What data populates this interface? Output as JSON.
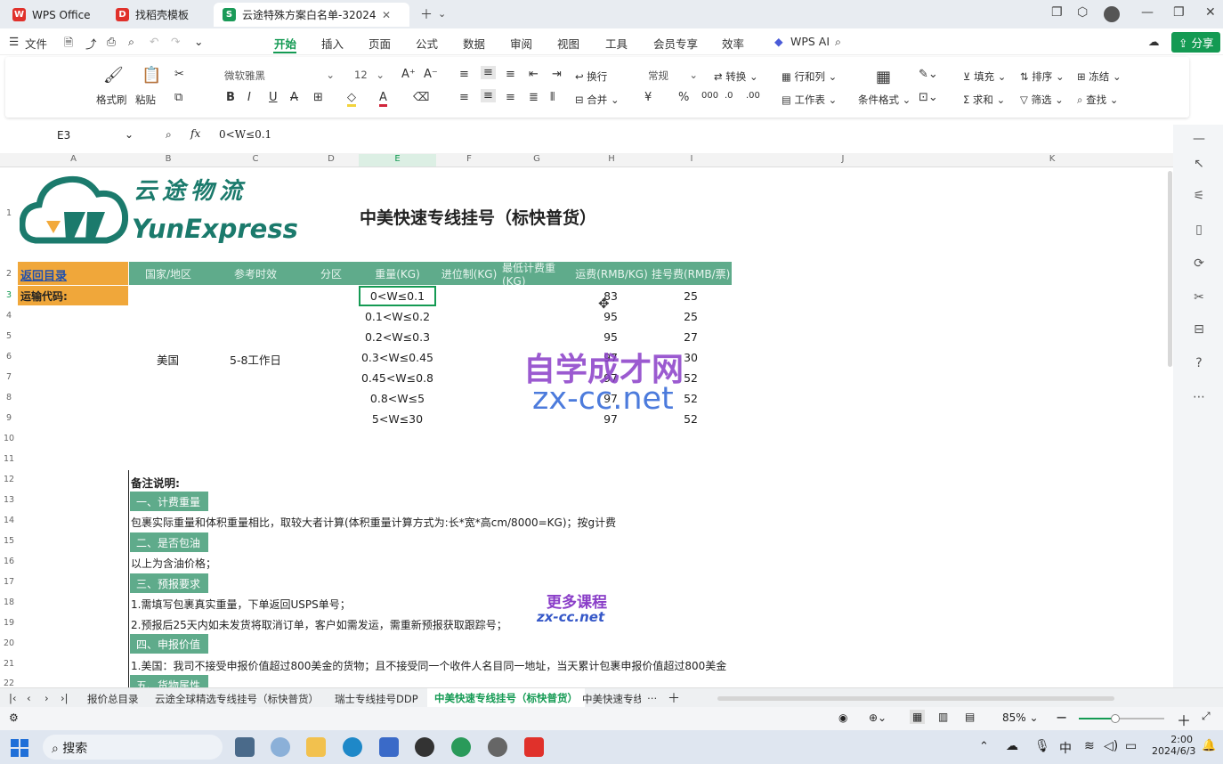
{
  "titlebar": {
    "tabs": [
      {
        "label": "WPS Office"
      },
      {
        "label": "找稻壳模板"
      },
      {
        "label": "云途特殊方案白名单-32024-"
      }
    ]
  },
  "menu": {
    "file": "文件",
    "items": [
      "开始",
      "插入",
      "页面",
      "公式",
      "数据",
      "审阅",
      "视图",
      "工具",
      "会员专享",
      "效率"
    ],
    "ai": "WPS AI",
    "share": "分享"
  },
  "ribbon": {
    "format_painter": "格式刷",
    "paste": "粘贴",
    "font": "微软雅黑",
    "font_size": "12",
    "wrap": "换行",
    "merge": "合并",
    "number_format": "常规",
    "convert": "转换",
    "rows_cols": "行和列",
    "worksheet": "工作表",
    "cond_format": "条件格式",
    "fill": "填充",
    "sort": "排序",
    "freeze": "冻结",
    "sum": "求和",
    "filter": "筛选",
    "find": "查找",
    "currency": "¥",
    "percent": "%"
  },
  "formula": {
    "name_box": "E3",
    "value": "0<W≤0.1"
  },
  "columns": [
    "A",
    "B",
    "C",
    "D",
    "E",
    "F",
    "G",
    "H",
    "I",
    "J",
    "K"
  ],
  "rows": [
    "1",
    "2",
    "3",
    "4",
    "5",
    "6",
    "7",
    "8",
    "9",
    "10",
    "11",
    "12",
    "13",
    "14",
    "15",
    "16",
    "17",
    "18",
    "19",
    "20",
    "21",
    "22"
  ],
  "logo": {
    "cn": "云途物流",
    "en": "YunExpress"
  },
  "sheet": {
    "title": "中美快速专线挂号（标快普货）",
    "back": "返回目录",
    "transport_code": "运输代码:",
    "headers": [
      "国家/地区",
      "参考时效",
      "分区",
      "重量(KG)",
      "进位制(KG)",
      "最低计费重(KG)",
      "运费(RMB/KG)",
      "挂号费(RMB/票)"
    ],
    "country": "美国",
    "timeliness": "5-8工作日",
    "weights": [
      "0<W≤0.1",
      "0.1<W≤0.2",
      "0.2<W≤0.3",
      "0.3<W≤0.45",
      "0.45<W≤0.8",
      "0.8<W≤5",
      "5<W≤30"
    ],
    "freight": [
      "83",
      "95",
      "95",
      "97",
      "97",
      "97",
      "97"
    ],
    "reg_fee": [
      "25",
      "25",
      "27",
      "30",
      "52",
      "52",
      "52"
    ],
    "notes_title": "备注说明:",
    "sec1": "一、计费重量",
    "line1": "包裹实际重量和体积重量相比，取较大者计算(体积重量计算方式为:长*宽*高cm/8000=KG)；按g计费",
    "sec2": "二、是否包油",
    "line2": "以上为含油价格；",
    "sec3": "三、预报要求",
    "line3a": "1.需填写包裹真实重量，下单返回USPS单号；",
    "line3b": "2.预报后25天内如未发货将取消订单，客户如需发运，需重新预报获取跟踪号；",
    "sec4": "四、申报价值",
    "line4": "1.美国：我司不接受申报价值超过800美金的货物；且不接受同一个收件人名目同一地址，当天累计包裹申报价值超过800美金",
    "sec5": "五、货物属性"
  },
  "watermark": {
    "big_cn": "自学成才网",
    "big_en": "zx-cc.net",
    "small_cn": "更多课程",
    "small_en": "zx-cc.net"
  },
  "sheets": [
    "报价总目录",
    "云途全球精选专线挂号（标快普货）",
    "瑞士专线挂号DDP",
    "中美快速专线挂号（标快普货）",
    "中美快速专线"
  ],
  "status": {
    "zoom": "85%"
  },
  "taskbar": {
    "search": "搜索",
    "time": "2:00",
    "date": "2024/6/3",
    "ime": "中"
  },
  "colors": {
    "accent": "#149a53",
    "header_green": "#5fab8b",
    "back_orange": "#f0a73a"
  }
}
